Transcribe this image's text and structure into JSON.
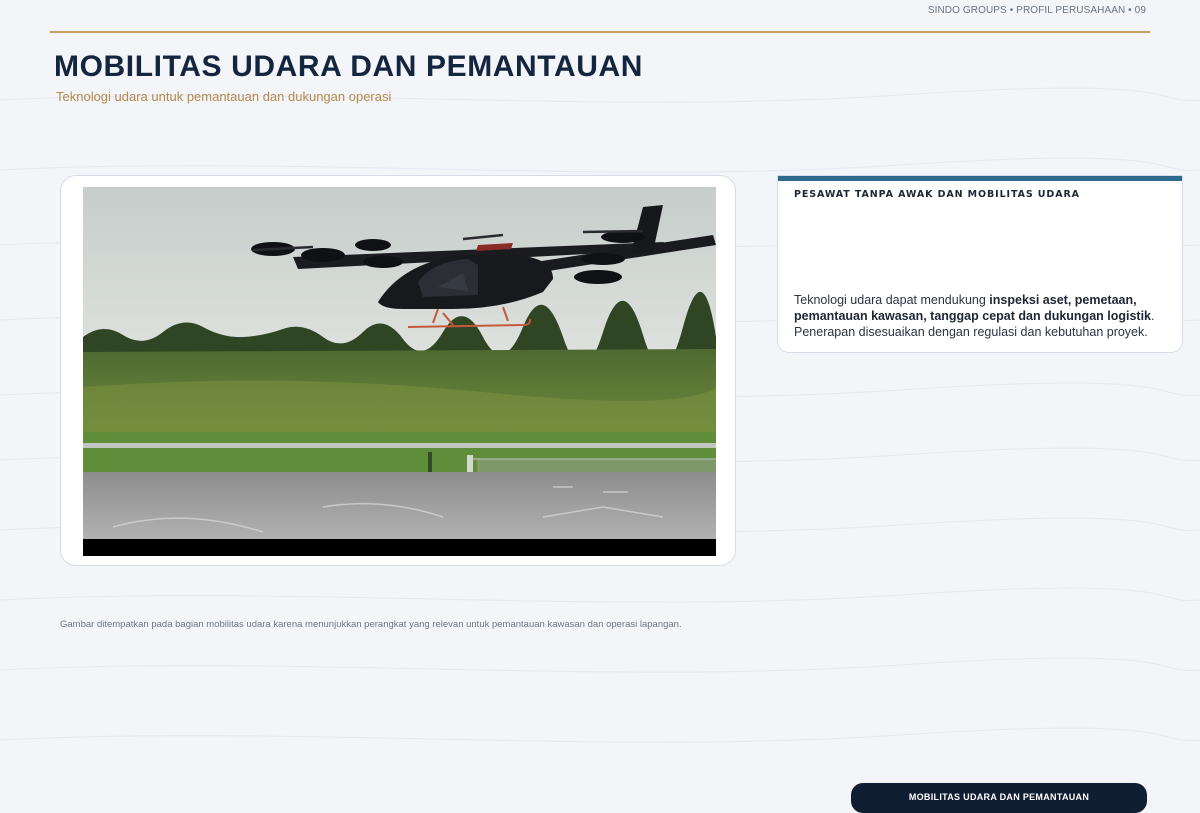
{
  "header": {
    "running_label": "SINDO GROUPS • PROFIL PERUSAHAAN • 09",
    "title": "MOBILITAS UDARA DAN PEMANTAUAN",
    "subtitle": "Teknologi udara untuk pemantauan dan dukungan operasi"
  },
  "image_card": {
    "alt": "Pesawat eVTOL hitam melayang di atas landasan"
  },
  "info_card": {
    "heading": "PESAWAT TANPA AWAK DAN MOBILITAS UDARA",
    "body_prefix": "Teknologi udara dapat mendukung ",
    "body_bold": "inspeksi aset, pemetaan, pemantauan kawasan, tanggap cepat dan dukungan logistik",
    "body_suffix": ". Penerapan disesuaikan dengan regulasi dan kebutuhan proyek."
  },
  "caption": "Gambar ditempatkan pada bagian mobilitas udara karena menunjukkan perangkat yang relevan untuk pemantauan kawasan dan operasi lapangan.",
  "footer": {
    "label": "MOBILITAS UDARA DAN PEMANTAUAN"
  },
  "colors": {
    "title": "#14263f",
    "accent_gold": "#c9a26b",
    "accent_blue": "#2d6a8b",
    "footer_bg": "#0f1e33"
  }
}
